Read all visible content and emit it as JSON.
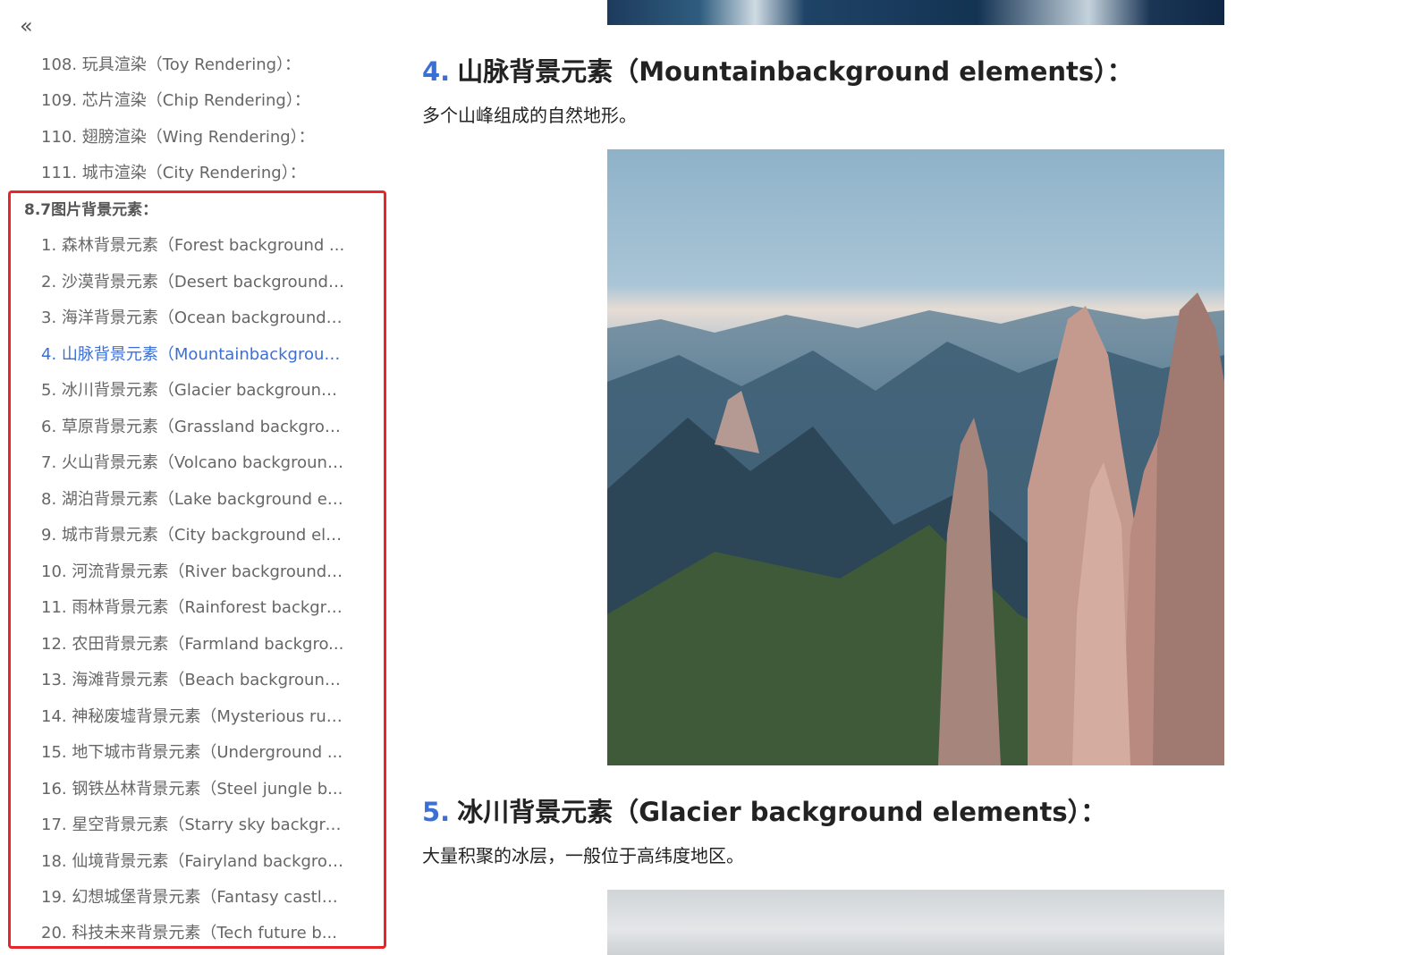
{
  "sidebar": {
    "collapse_label": "«",
    "items_before": [
      "108. 玩具渲染（Toy Rendering）：",
      "109. 芯片渲染（Chip Rendering）：",
      "110. 翅膀渲染（Wing Rendering）：",
      "111. 城市渲染（City Rendering）："
    ],
    "section_title": "8.7图片背景元素：",
    "items": [
      "1. 森林背景元素（Forest background ...",
      "2. 沙漠背景元素（Desert background ...",
      "3. 海洋背景元素（Ocean background ...",
      "4. 山脉背景元素（Mountainbackgroun...",
      "5. 冰川背景元素（Glacier background ...",
      "6. 草原背景元素（Grassland backgrou...",
      "7. 火山背景元素（Volcano background...",
      "8. 湖泊背景元素（Lake background el...",
      "9. 城市背景元素（City background ele...",
      "10. 河流背景元素（River background ...",
      "11. 雨林背景元素（Rainforest backgro...",
      "12. 农田背景元素（Farmland backgro...",
      "13. 海滩背景元素（Beach background...",
      "14. 神秘废墟背景元素（Mysterious rui...",
      "15. 地下城市背景元素（Underground ...",
      "16. 钢铁丛林背景元素（Steel jungle b...",
      "17. 星空背景元素（Starry sky backgro...",
      "18. 仙境背景元素（Fairyland backgrou...",
      "19. 幻想城堡背景元素（Fantasy castle...",
      "20. 科技未来背景元素（Tech future b..."
    ],
    "active_index": 3,
    "accent_color": "#3a6fd8",
    "highlight_color": "#e8262a"
  },
  "main": {
    "sections": [
      {
        "num": "4.",
        "title": "山脉背景元素（Mountainbackground elements）：",
        "desc": "多个山峰组成的自然地形。"
      },
      {
        "num": "5.",
        "title": "冰川背景元素（Glacier background elements）：",
        "desc": "大量积聚的冰层，一般位于高纬度地区。"
      }
    ]
  }
}
